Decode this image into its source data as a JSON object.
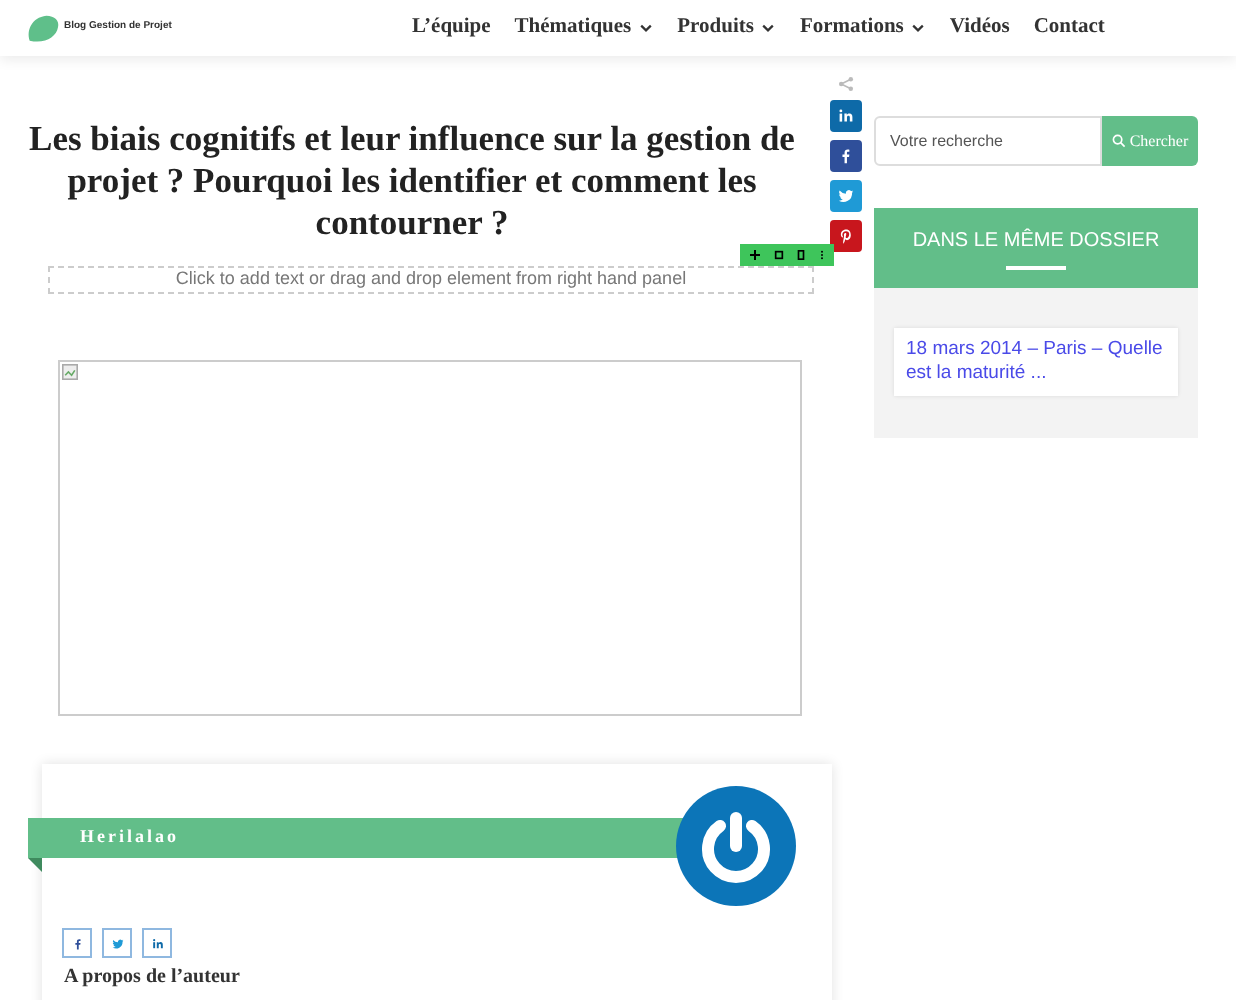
{
  "logo": {
    "text": "Blog Gestion de Projet"
  },
  "nav": [
    {
      "label": "L’équipe",
      "dropdown": false
    },
    {
      "label": "Thématiques",
      "dropdown": true
    },
    {
      "label": "Produits",
      "dropdown": true
    },
    {
      "label": "Formations",
      "dropdown": true
    },
    {
      "label": "Vidéos",
      "dropdown": false
    },
    {
      "label": "Contact",
      "dropdown": false
    }
  ],
  "article": {
    "title": "Les biais cognitifs et leur influence sur la gestion de projet ? Pourquoi les identifier et comment les contourner ?",
    "editor_placeholder": "Click to add text or drag and drop element from right hand panel"
  },
  "share": [
    {
      "kind": "linkedin",
      "color": "#0e6aa8"
    },
    {
      "kind": "facebook",
      "color": "#2f4f9a"
    },
    {
      "kind": "twitter",
      "color": "#1f9ad6"
    },
    {
      "kind": "pinterest",
      "color": "#c8161d"
    }
  ],
  "author": {
    "name": "Herilalao",
    "socials": [
      {
        "kind": "facebook"
      },
      {
        "kind": "twitter"
      },
      {
        "kind": "linkedin"
      }
    ],
    "about": "A propos de l’auteur"
  },
  "search": {
    "placeholder": "Votre recherche",
    "button": "Chercher"
  },
  "dossier": {
    "title": "DANS LE MÊME DOSSIER",
    "items": [
      "18 mars 2014 – Paris – Quelle est la maturité ..."
    ]
  }
}
